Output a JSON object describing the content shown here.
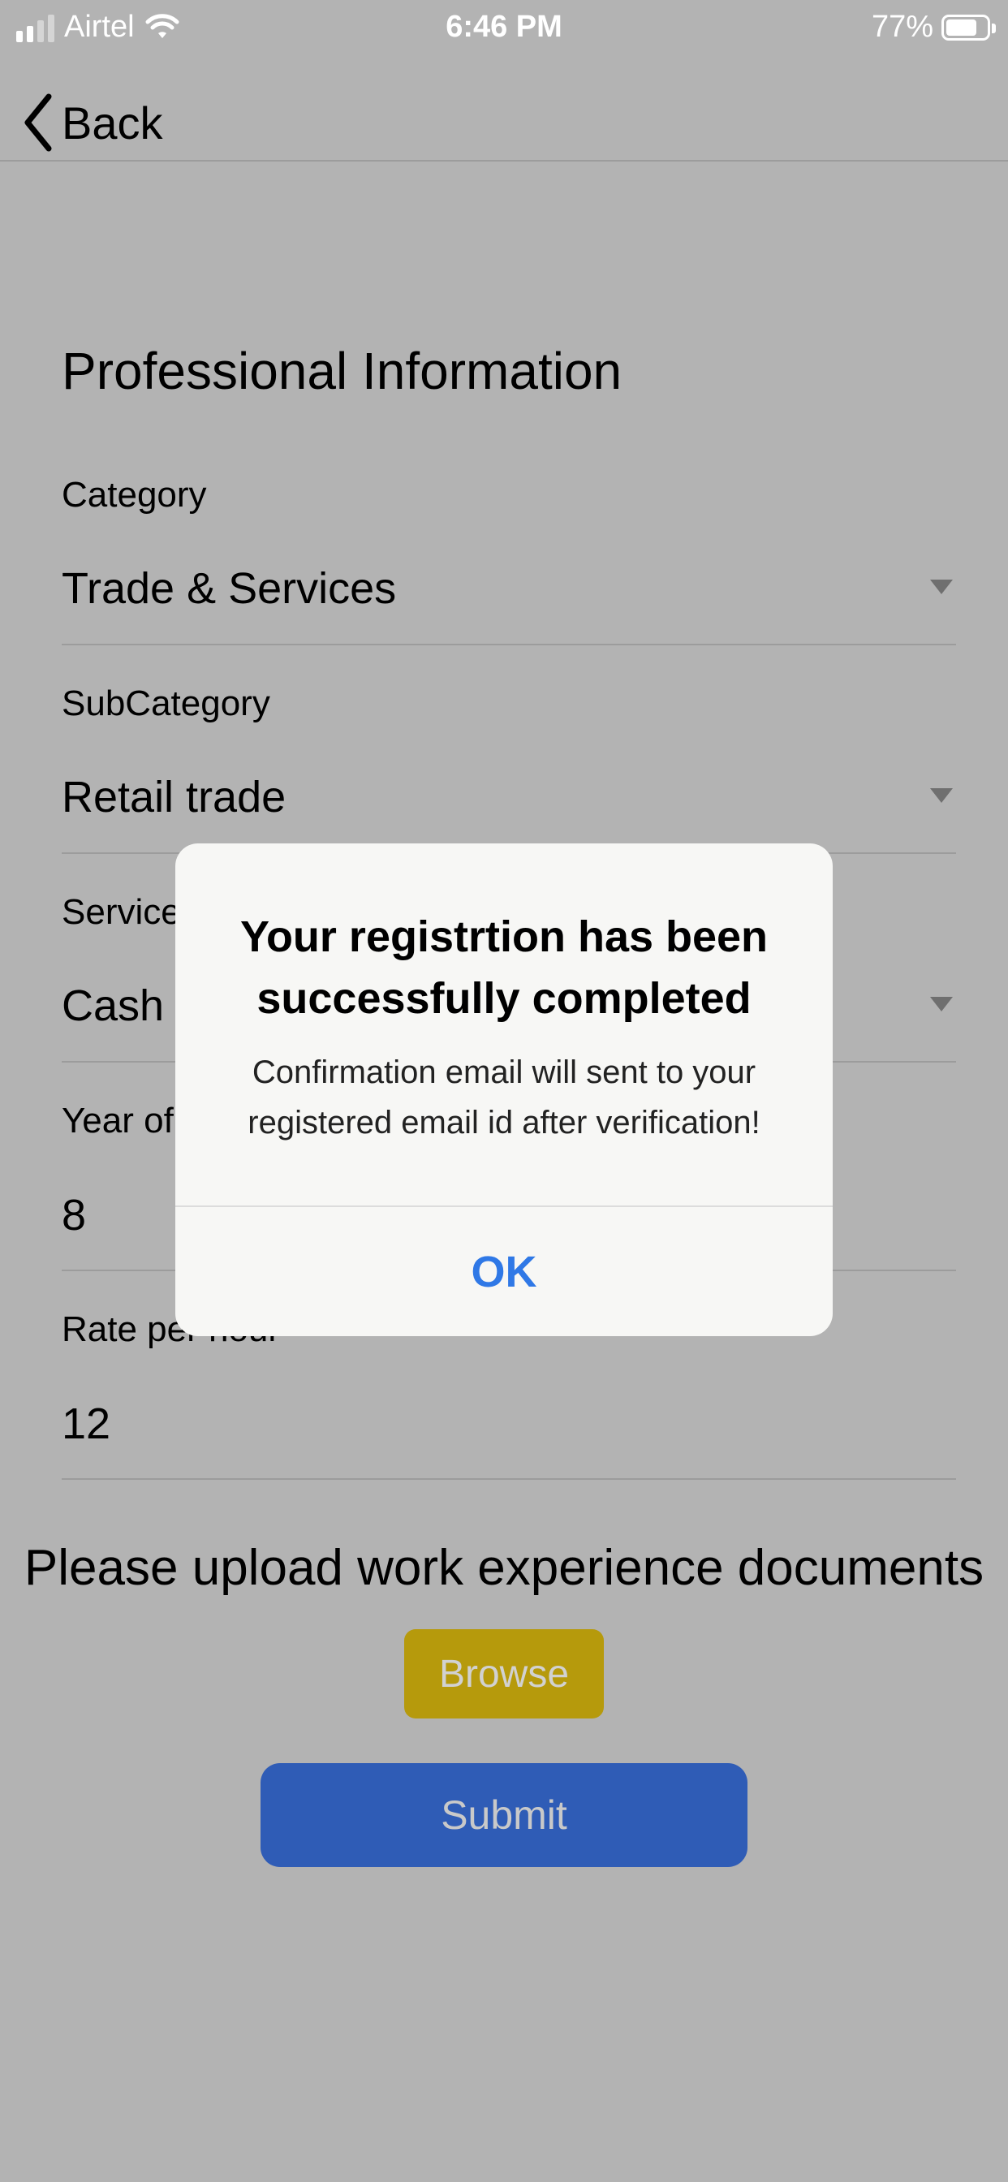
{
  "status_bar": {
    "carrier": "Airtel",
    "time": "6:46 PM",
    "battery_percent": "77%",
    "battery_level": 0.77,
    "icons": [
      "signal-icon",
      "wifi-icon",
      "battery-icon"
    ]
  },
  "nav": {
    "back_label": "Back",
    "back_icon": "chevron-left-icon"
  },
  "form": {
    "section_title": "Professional Information",
    "fields": [
      {
        "label": "Category",
        "value": "Trade & Services",
        "dropdown": true
      },
      {
        "label": "SubCategory",
        "value": "Retail trade",
        "dropdown": true
      },
      {
        "label": "Service",
        "value": "Cash r",
        "dropdown": true
      },
      {
        "label": "Year of",
        "value": "8",
        "dropdown": false
      },
      {
        "label": "Rate per hour",
        "value": "12",
        "dropdown": false
      }
    ]
  },
  "upload": {
    "title": "Please upload work experience documents",
    "browse_label": "Browse",
    "submit_label": "Submit"
  },
  "alert": {
    "title": "Your registrtion has been successfully completed",
    "message": "Confirmation email will sent to your registered email id after verification!",
    "ok_label": "OK"
  },
  "colors": {
    "overlay_background": "#b3b3b3",
    "browse_button": "#b69a0c",
    "submit_button": "#2f5cb6",
    "alert_action": "#2f78e6"
  }
}
